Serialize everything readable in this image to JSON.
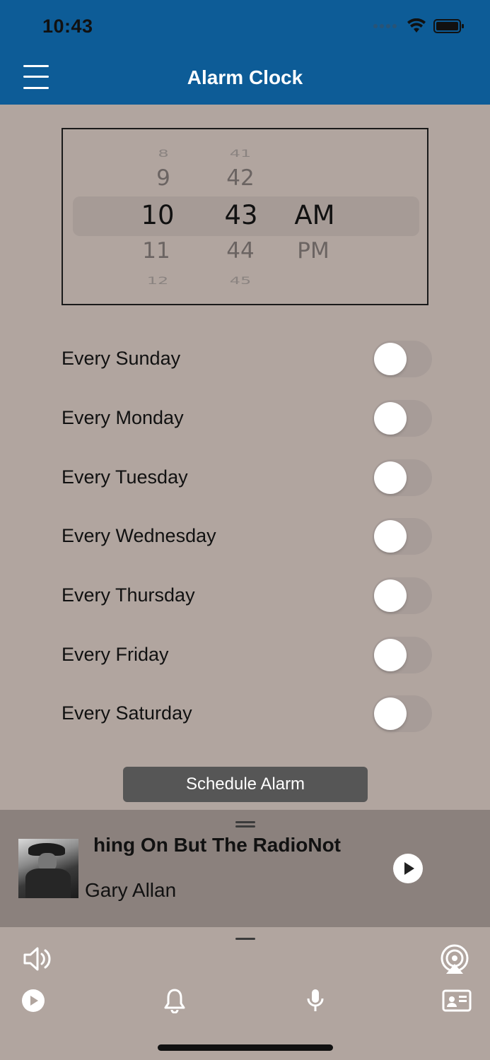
{
  "status_bar": {
    "time": "10:43"
  },
  "header": {
    "title": "Alarm Clock"
  },
  "picker": {
    "hours": [
      "8",
      "9",
      "10",
      "11",
      "12"
    ],
    "minutes": [
      "41",
      "42",
      "43",
      "44",
      "45"
    ],
    "periods": [
      "AM",
      "PM"
    ],
    "selected": {
      "hour": "10",
      "minute": "43",
      "period": "AM"
    }
  },
  "days": [
    {
      "label": "Every Sunday",
      "on": false
    },
    {
      "label": "Every Monday",
      "on": false
    },
    {
      "label": "Every Tuesday",
      "on": false
    },
    {
      "label": "Every Wednesday",
      "on": false
    },
    {
      "label": "Every Thursday",
      "on": false
    },
    {
      "label": "Every Friday",
      "on": false
    },
    {
      "label": "Every Saturday",
      "on": false
    }
  ],
  "schedule_button": "Schedule Alarm",
  "now_playing": {
    "title": "hing On But The RadioNot",
    "artist": "Gary Allan"
  },
  "icons": {
    "volume": "speaker-icon",
    "airplay": "airplay-icon",
    "play": "play-icon",
    "alarm": "bell-icon",
    "mic": "microphone-icon",
    "contact": "contact-card-icon"
  },
  "colors": {
    "header": "#0d5c97",
    "background": "#b1a59f",
    "player": "#8b817d",
    "button": "#565656"
  }
}
